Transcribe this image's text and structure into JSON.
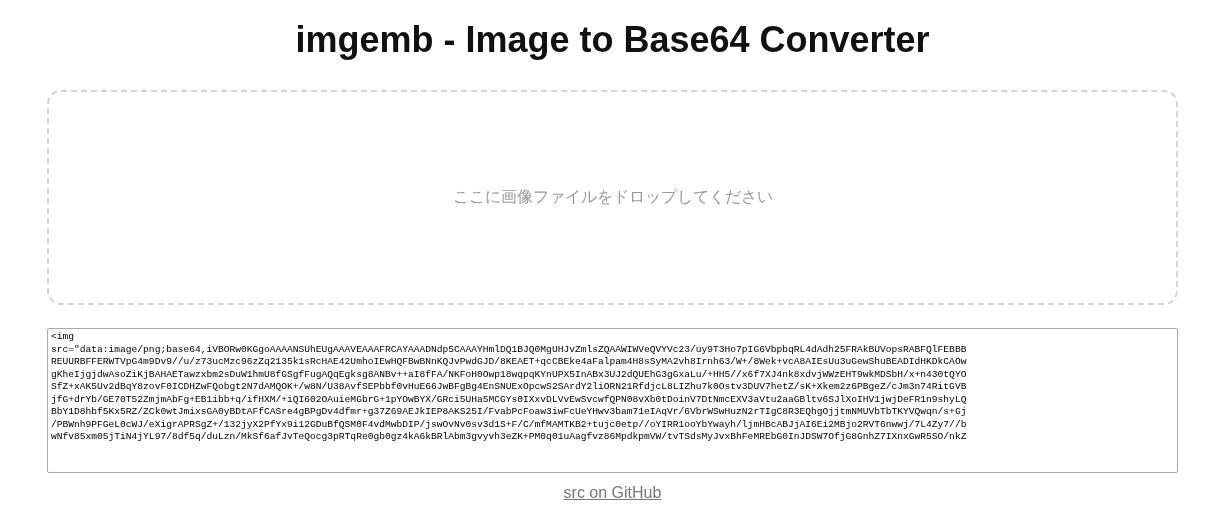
{
  "title": "imgemb - Image to Base64 Converter",
  "drop_zone": {
    "label": "ここに画像ファイルをドロップしてください"
  },
  "output": {
    "lines": [
      "<img",
      "src=\"data:image/png;base64,iVBORw0KGgoAAAANSUhEUgAAAVEAAAFRCAYAAADNdp5CAAAYHmlDQ1BJQ0MgUHJvZmlsZQAAWIWVeQVYVc23/uy9T3Ho7pIG6VbpbqRL4dAdh25FRAkBUVopsRABFQlFEBBB",
      "REUURBFFERWTVpG4m9Dv9//u/z73ucMzc96zZq2135k1sRcHAE42UmhoIEwHQFBwBNnKQJvPwdGJD/8KEAET+qcCBEke4aFalpam4H8sSyMA2vh8Irnh63/W+/8Wek+vcA8AIEsUu3uGewShuBEADIdHKDkCAOw",
      "gKheIjgjdwAsoZiKjBAHAETawzxbm2sDuW1hmU8fGSgfFugAQqEgksg8ANBv++aI8fFA/NKFoH0Owp18wqpqKYnUPX5InABx3UJ2dQUEhG3gGxaLu/+HH5//x6f7XJ4nk8xdvjWWzEHT9wkMDSbH/x+n430tQYO",
      "SfZ+xAK5Uv2dBqY8zovF0ICDHZwFQobgt2N7dAMQOK+/w8N/U38AvfSEPbbf0vHuE66JwBFgBg4EnSNUExOpcwS2SArdY2liORN21RfdjcL8LIZhu7k0Ostv3DUV7hetZ/sK+Xkem2z6PBgeZ/cJm3n74RitGVB",
      "jfG+drYb/GE70T52ZmjmAbFg+EB1ibb+q/ifHXM/+iQI602OAuieMGbrG+1pYOwBYX/GRci5UHa5MCGYs0IXxvDLVvEwSvcwfQPN08vXb0tDoinV7DtNmcEXV3aVtu2aaGBltv6SJlXoIHV1jwjDeFR1n9shyLQ",
      "BbY1D8hbf5Kx5RZ/ZCk0wtJmixsGA0yBDtAFfCASre4gBPgDv4dfmr+g37Z69AEJkIEP8AKS25I/FvabPcFoaw3iwFcUeYHwv3bam71eIAqVr/6VbrWSwHuzN2rTIgC8R3EQhgOjjtmNMUVbTbTKYVQwqn/s+Gj",
      "/PBWnh9PFGeL0cWJ/eXigrAPRSgZ+/132jyX2PfYx9i12GDuBfQSM0F4vdMwbDIP/jswOvNv0sv3d1S+F/C/mfMAMTKB2+tujc0etp//oYIRR1ooYbYwayh/ljmHBcABJjAI6Ei2MBjo2RVT6nwwj/7L4Zy7//b",
      "wNfv85xm05jTiN4jYL97/8df5q/duLzn/MkSf6afJvTeQocg3pRTqRe0gb0gz4kA6kBRlAbm3gvyvh3eZK+PM0q01uAagfvz86MpdkpmVW/tvTSdsMyJvxBhFeMREbG0InJDSW7OfjG8GnhZ7IXnxGwR5SO/nkZ"
    ]
  },
  "footer_link": "src on GitHub"
}
